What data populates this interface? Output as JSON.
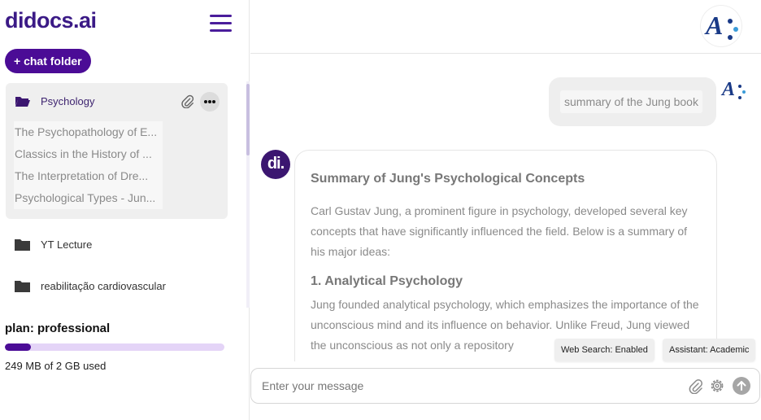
{
  "sidebar": {
    "logo": "didocs.ai",
    "new_folder_label": "+ chat folder",
    "active_folder": {
      "label": "Psychology",
      "documents": [
        "The Psychopathology of E...",
        "Classics in the History of ...",
        "The Interpretation of Dre...",
        "Psychological Types - Jun..."
      ]
    },
    "folders": [
      {
        "label": "YT Lecture"
      },
      {
        "label": "reabilitação cardiovascular"
      }
    ],
    "plan": "plan: professional",
    "usage_text": "249 MB of 2 GB used",
    "usage_fraction": 0.12
  },
  "chat": {
    "user_message": "summary of the Jung book",
    "bot_avatar_text": "di.",
    "response": {
      "title": "Summary of Jung's Psychological Concepts",
      "intro": "Carl Gustav Jung, a prominent figure in psychology, developed several key concepts that have significantly influenced the field. Below is a summary of his major ideas:",
      "section_1_heading": "1. Analytical Psychology",
      "section_1_text": "Jung founded analytical psychology, which emphasizes the importance of the unconscious mind and its influence on behavior. Unlike Freud, Jung viewed the unconscious as not only a repository"
    }
  },
  "status": {
    "web_search": "Web Search: Enabled",
    "assistant": "Assistant: Academic"
  },
  "composer": {
    "placeholder": "Enter your message"
  },
  "colors": {
    "brand": "#4b0c96",
    "logo": "#3b1a86",
    "avatar_blue": "#1a3a87"
  }
}
